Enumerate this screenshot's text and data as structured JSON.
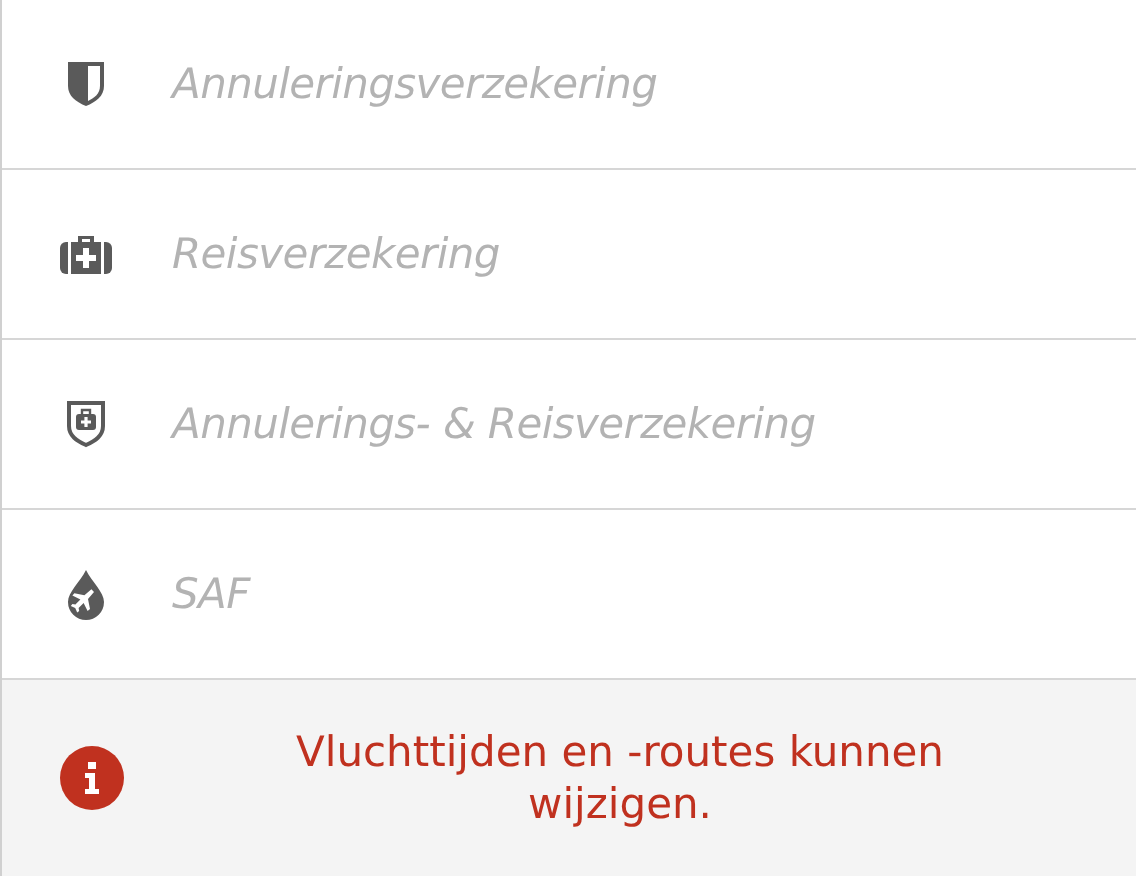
{
  "options": [
    {
      "kind": "shield",
      "label": "Annuleringsverzekering",
      "disabled": true
    },
    {
      "kind": "case",
      "label": "Reisverzekering",
      "disabled": true
    },
    {
      "kind": "shieldcase",
      "label": "Annulerings- & Reisverzekering",
      "disabled": true
    },
    {
      "kind": "drop",
      "label": "SAF",
      "disabled": true
    }
  ],
  "notice": {
    "text": "Vluchttijden en -routes kunnen wijzigen."
  }
}
